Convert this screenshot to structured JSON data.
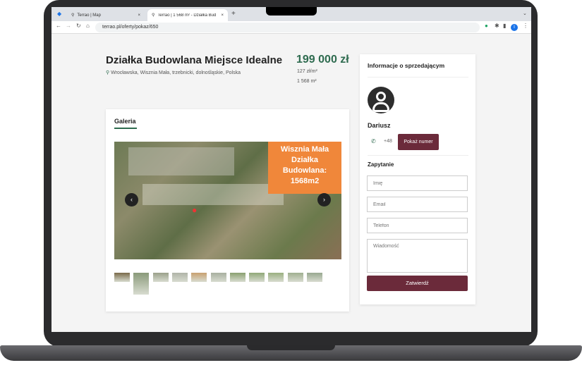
{
  "browser": {
    "tabs": [
      {
        "label": "Terrao | Map"
      },
      {
        "label": "Terrao | 1 568 m² - Działka Bud"
      }
    ],
    "url": "terrao.pl/oferty/pokaz/650",
    "profile_initial": "I"
  },
  "listing": {
    "title": "Działka Budowlana Miejsce Idealne",
    "address": "Wrocławska, Wisznia Mała, trzebnicki, dolnośląskie, Polska",
    "price": "199 000 zł",
    "price_per_m2": "127 zł/m²",
    "area": "1 568 m²"
  },
  "gallery": {
    "title": "Galeria",
    "overlay_label": "Wisznia Mała Działka Budowlana: 1568m2",
    "thumbnail_count": 11,
    "selected_thumbnail": 2
  },
  "seller": {
    "title": "Informacje o sprzedającym",
    "name": "Dariusz",
    "phone_prefix": "+48",
    "show_number": "Pokaż numer"
  },
  "inquiry": {
    "title": "Zapytanie",
    "name_placeholder": "Imię",
    "email_placeholder": "Email",
    "phone_placeholder": "Telefon",
    "message_placeholder": "Wiadomość",
    "submit": "Zatwierdź"
  },
  "colors": {
    "price": "#2e6b4f",
    "accent": "#6b2a3a",
    "overlay": "#f0873a"
  }
}
